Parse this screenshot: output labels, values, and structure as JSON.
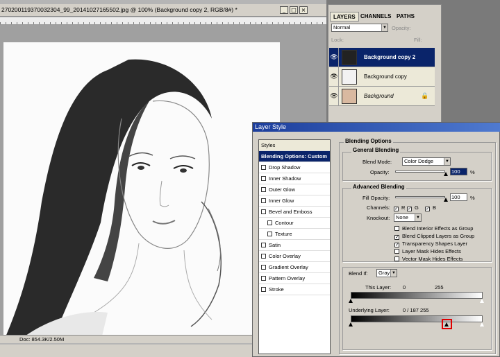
{
  "document": {
    "title": "270200119370032304_99_20141027165502.jpg @ 100% (Background copy 2, RGB/8#) *",
    "status": "Doc: 854.3K/2.50M"
  },
  "layers_panel": {
    "tabs": [
      "LAYERS",
      "CHANNELS",
      "PATHS"
    ],
    "blend_mode": "Normal",
    "opacity_label": "Opacity:",
    "lock_label": "Lock:",
    "fill_label": "Fill:",
    "layers": [
      {
        "name": "Background copy 2",
        "selected": true
      },
      {
        "name": "Background copy",
        "selected": false
      },
      {
        "name": "Background",
        "selected": false
      }
    ]
  },
  "dialog": {
    "title": "Layer Style",
    "styles_list": [
      {
        "label": "Styles",
        "type": "head"
      },
      {
        "label": "Blending Options: Custom",
        "type": "selected"
      },
      {
        "label": "Drop Shadow",
        "type": "check"
      },
      {
        "label": "Inner Shadow",
        "type": "check"
      },
      {
        "label": "Outer Glow",
        "type": "check"
      },
      {
        "label": "Inner Glow",
        "type": "check"
      },
      {
        "label": "Bevel and Emboss",
        "type": "check"
      },
      {
        "label": "Contour",
        "type": "subcheck"
      },
      {
        "label": "Texture",
        "type": "subcheck"
      },
      {
        "label": "Satin",
        "type": "check"
      },
      {
        "label": "Color Overlay",
        "type": "check"
      },
      {
        "label": "Gradient Overlay",
        "type": "check"
      },
      {
        "label": "Pattern Overlay",
        "type": "check"
      },
      {
        "label": "Stroke",
        "type": "check"
      }
    ],
    "blending_options": "Blending Options",
    "general_blending": "General Blending",
    "blend_mode_label": "Blend Mode:",
    "blend_mode_value": "Color Dodge",
    "opacity_label": "Opacity:",
    "opacity_value": "100",
    "percent": "%",
    "advanced_blending": "Advanced Blending",
    "fill_opacity_label": "Fill Opacity:",
    "fill_opacity_value": "100",
    "channels_label": "Channels:",
    "channels": [
      "R",
      "G",
      "B"
    ],
    "knockout_label": "Knockout:",
    "knockout_value": "None",
    "options": [
      {
        "label": "Blend Interior Effects as Group",
        "checked": false
      },
      {
        "label": "Blend Clipped Layers as Group",
        "checked": true
      },
      {
        "label": "Transparency Shapes Layer",
        "checked": true
      },
      {
        "label": "Layer Mask Hides Effects",
        "checked": false
      },
      {
        "label": "Vector Mask Hides Effects",
        "checked": false
      }
    ],
    "blend_if_label": "Blend If:",
    "blend_if_value": "Gray",
    "this_layer_label": "This Layer:",
    "this_layer_low": "0",
    "this_layer_high": "255",
    "underlying_label": "Underlying Layer:",
    "underlying_value": "0  /  187     255"
  },
  "colors": {
    "highlight": "#0a246a",
    "marker": "#e00000"
  }
}
